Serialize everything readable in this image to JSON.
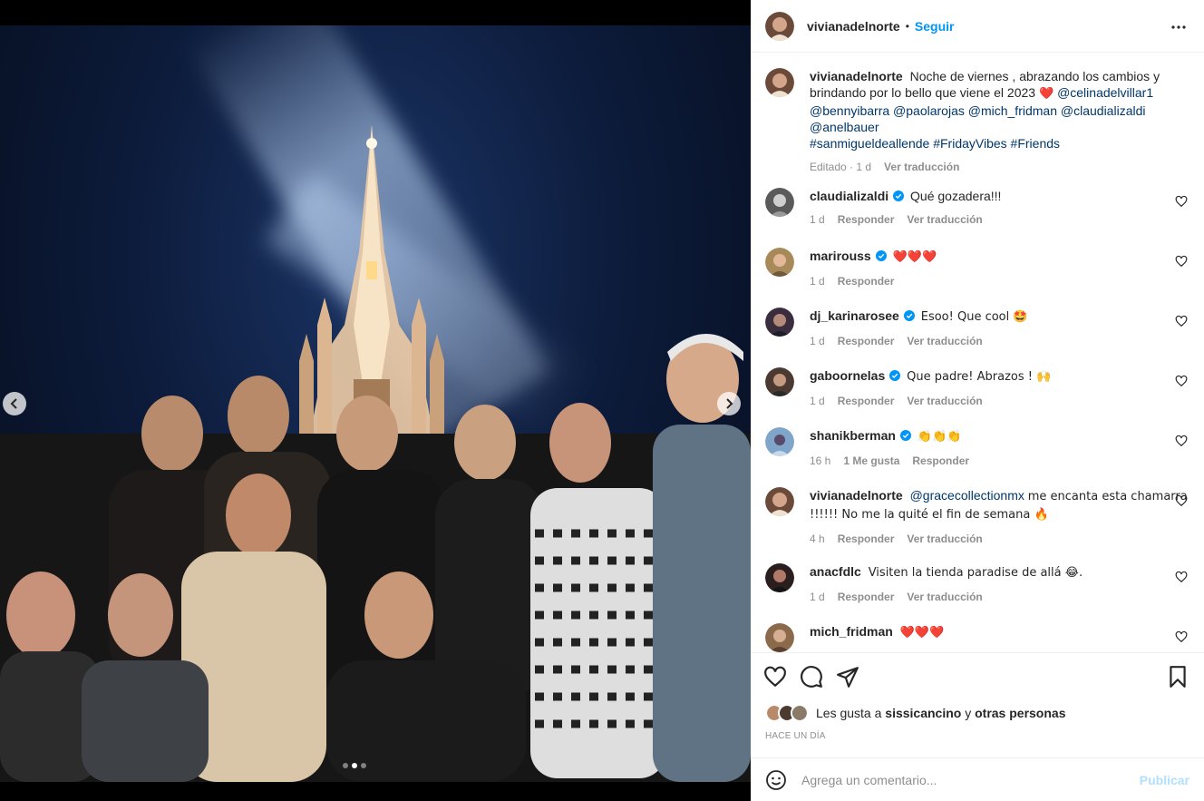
{
  "media": {
    "dot_count": 3,
    "active_dot": 1
  },
  "header": {
    "username": "vivianadelnorte",
    "separator": "•",
    "follow_label": "Seguir"
  },
  "caption": {
    "username": "vivianadelnorte",
    "text_line": "Noche de viernes , abrazando los cambios y brindando por lo bello que viene el 2023",
    "emoji": "❤️",
    "mentions": [
      "@celinadelvillar1",
      "@bennyibarra",
      "@paolarojas",
      "@mich_fridman",
      "@claudializaldi",
      "@anelbauer"
    ],
    "hashtags": "#sanmigueldeallende #FridayVibes #Friends",
    "edited": "Editado · 1 d",
    "translate": "Ver traducción"
  },
  "comments": [
    {
      "username": "claudializaldi",
      "verified": true,
      "text": "Qué gozadera!!!",
      "time": "1 d",
      "likes": "",
      "reply": "Responder",
      "translate": "Ver traducción"
    },
    {
      "username": "marirouss",
      "verified": true,
      "text": "❤️❤️❤️",
      "time": "1 d",
      "likes": "",
      "reply": "Responder",
      "translate": ""
    },
    {
      "username": "dj_karinarosee",
      "verified": true,
      "text": "Esoo! Que cool 🤩",
      "time": "1 d",
      "likes": "",
      "reply": "Responder",
      "translate": "Ver traducción"
    },
    {
      "username": "gaboornelas",
      "verified": true,
      "text": "Que padre! Abrazos ! 🙌",
      "time": "1 d",
      "likes": "",
      "reply": "Responder",
      "translate": "Ver traducción"
    },
    {
      "username": "shanikberman",
      "verified": true,
      "text": "👏👏👏",
      "time": "16 h",
      "likes": "1 Me gusta",
      "reply": "Responder",
      "translate": ""
    },
    {
      "username": "vivianadelnorte",
      "verified": false,
      "mention": "@gracecollectionmx",
      "text": "me encanta esta chamarra !!!!!! No me la quité el fin de semana 🔥",
      "time": "4 h",
      "likes": "",
      "reply": "Responder",
      "translate": "Ver traducción"
    },
    {
      "username": "anacfdlc",
      "verified": false,
      "text": "Visiten la tienda paradise de allá 😂.",
      "time": "1 d",
      "likes": "",
      "reply": "Responder",
      "translate": "Ver traducción"
    },
    {
      "username": "mich_fridman",
      "verified": false,
      "text": "❤️❤️❤️",
      "time": "",
      "likes": "",
      "reply": "",
      "translate": ""
    }
  ],
  "likes": {
    "prefix": "Les gusta a",
    "user": "sissicancino",
    "conj": "y",
    "others": "otras personas"
  },
  "date_label": "HACE UN DÍA",
  "add_comment": {
    "placeholder": "Agrega un comentario...",
    "publish_label": "Publicar"
  },
  "colors": {
    "accent": "#0095f6",
    "link": "#00376b",
    "muted": "#8e8e8e",
    "publish_disabled": "#b2dffc"
  }
}
